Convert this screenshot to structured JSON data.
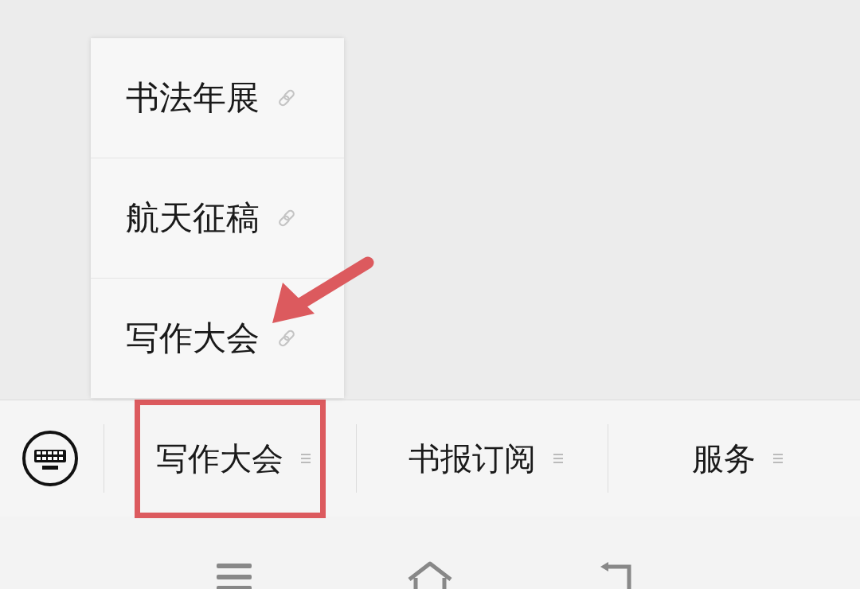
{
  "submenu": {
    "items": [
      {
        "label": "书法年展"
      },
      {
        "label": "航天征稿"
      },
      {
        "label": "写作大会"
      }
    ]
  },
  "menu_bar": {
    "items": [
      {
        "label": "写作大会",
        "highlighted": true
      },
      {
        "label": "书报订阅",
        "highlighted": false
      },
      {
        "label": "服务",
        "highlighted": false
      }
    ]
  },
  "annotations": [
    {
      "kind": "arrow"
    }
  ]
}
